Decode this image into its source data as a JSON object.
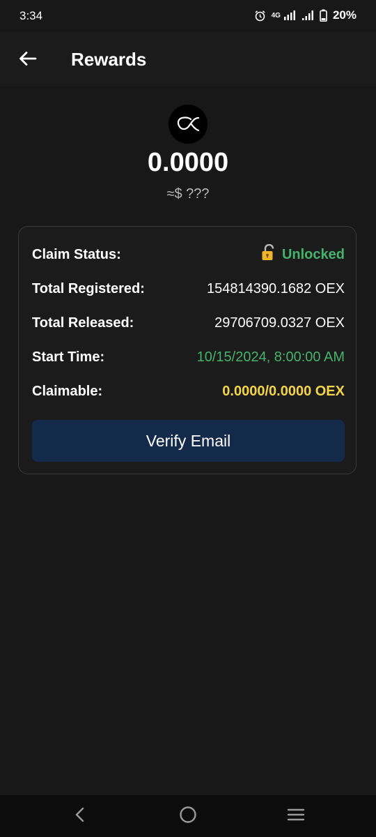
{
  "status_bar": {
    "time": "3:34",
    "network": "4G",
    "battery": "20%"
  },
  "header": {
    "title": "Rewards",
    "back_icon": "arrow-left-icon"
  },
  "balance": {
    "amount": "0.0000",
    "usd": "≈$ ???",
    "logo_icon": "oex-logo-icon"
  },
  "card": {
    "claim_status": {
      "label": "Claim Status:",
      "value": "Unlocked",
      "icon": "unlocked-padlock-icon"
    },
    "total_registered": {
      "label": "Total Registered:",
      "value": "154814390.1682 OEX"
    },
    "total_released": {
      "label": "Total Released:",
      "value": "29706709.0327 OEX"
    },
    "start_time": {
      "label": "Start Time:",
      "value": "10/15/2024, 8:00:00 AM"
    },
    "claimable": {
      "label": "Claimable:",
      "value": "0.0000/0.0000 OEX"
    },
    "verify_button": "Verify Email"
  },
  "colors": {
    "background": "#181818",
    "accent_green": "#45b36b",
    "accent_yellow": "#f5d547",
    "button_blue": "#132a4a"
  },
  "nav": {
    "back_icon": "nav-back-icon",
    "home_icon": "nav-home-icon",
    "menu_icon": "nav-menu-icon"
  }
}
